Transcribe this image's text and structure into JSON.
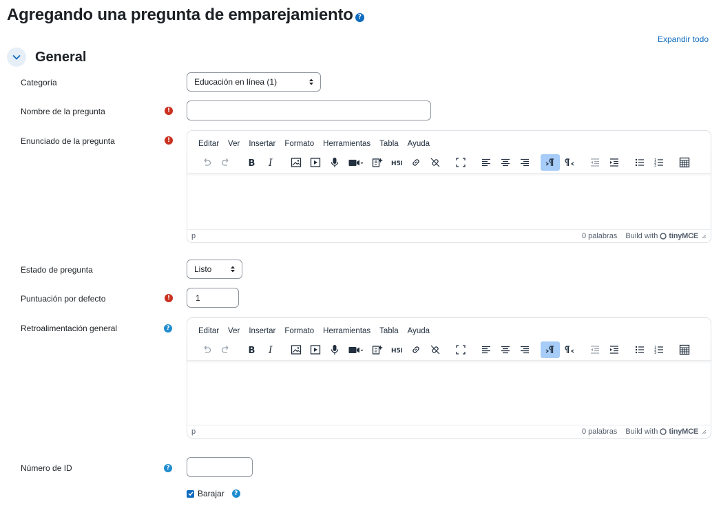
{
  "page": {
    "title": "Agregando una pregunta de emparejamiento",
    "expand_all": "Expandir todo"
  },
  "section": {
    "title": "General"
  },
  "fields": {
    "category": {
      "label": "Categoría",
      "value": "Educación en línea (1)"
    },
    "question_name": {
      "label": "Nombre de la pregunta",
      "value": ""
    },
    "question_text": {
      "label": "Enunciado de la pregunta"
    },
    "question_status": {
      "label": "Estado de pregunta",
      "value": "Listo"
    },
    "default_mark": {
      "label": "Puntuación por defecto",
      "value": "1"
    },
    "general_feedback": {
      "label": "Retroalimentación general"
    },
    "id_number": {
      "label": "Número de ID",
      "value": ""
    },
    "shuffle": {
      "label": "Barajar",
      "checked": true
    }
  },
  "editor": {
    "menu": [
      "Editar",
      "Ver",
      "Insertar",
      "Formato",
      "Herramientas",
      "Tabla",
      "Ayuda"
    ],
    "path": "p",
    "word_count": "0 palabras",
    "build_with": "Build with",
    "brand": "tinyMCE"
  },
  "colors": {
    "accent": "#0f6cbf",
    "required": "#ca3120",
    "active_button": "#a6ccf7"
  },
  "icons": {
    "required": "exclamation-circle",
    "help": "question-circle",
    "collapse": "chevron-down"
  }
}
